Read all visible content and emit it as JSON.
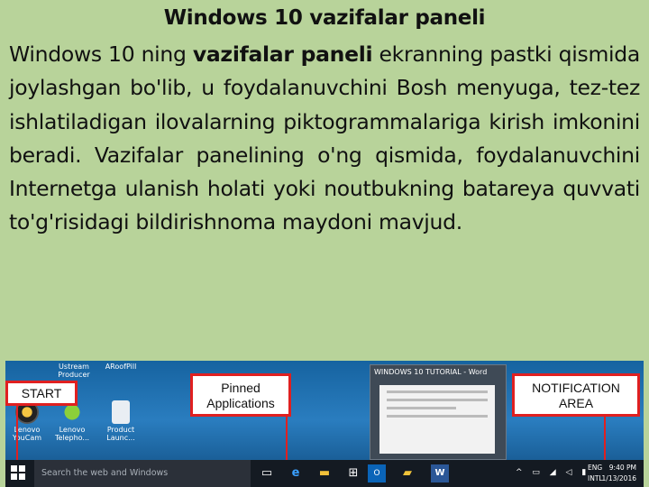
{
  "slide": {
    "title": "Windows 10  vazifalar paneli",
    "para_part1": "Windows 10 ning ",
    "para_bold": "vazifalar paneli",
    "para_part2": " ekranning pastki qismida joylashgan bo'lib, u foydalanuvchini Bosh menyuga, tez-tez ishlatiladigan ilovalarning piktogrammalariga kirish imkonini beradi. Vazifalar panelining o'ng qismida, foydalanuvchini Internetga ulanish holati yoki noutbukning batareya quvvati to'g'risidagi bildirishnoma maydoni mavjud."
  },
  "screenshot": {
    "desktop_icons": [
      {
        "label": "Ustream\nProducer",
        "icon": "app-icon"
      },
      {
        "label": "ARoofPill",
        "icon": "app-icon"
      },
      {
        "label": "Lenovo\nYouCam",
        "icon": "camera-icon"
      },
      {
        "label": "Lenovo\nTelepho...",
        "icon": "phone-icon"
      },
      {
        "label": "Product\nLaunc...",
        "icon": "document-icon"
      }
    ],
    "window_preview_title": "WINDOWS 10 TUTORIAL - Word",
    "labels": {
      "start": "START",
      "pinned": "Pinned\nApplications",
      "notification": "NOTIFICATION\nAREA"
    },
    "search_placeholder": "Search the web and Windows",
    "tray_lang_1": "ENG",
    "tray_lang_2": "INTL",
    "tray_time": "9:40 PM",
    "tray_date": "1/13/2016",
    "colors": {
      "background": "#b8d39a",
      "callout_border": "#e02020",
      "taskbar": "#141a22"
    }
  }
}
